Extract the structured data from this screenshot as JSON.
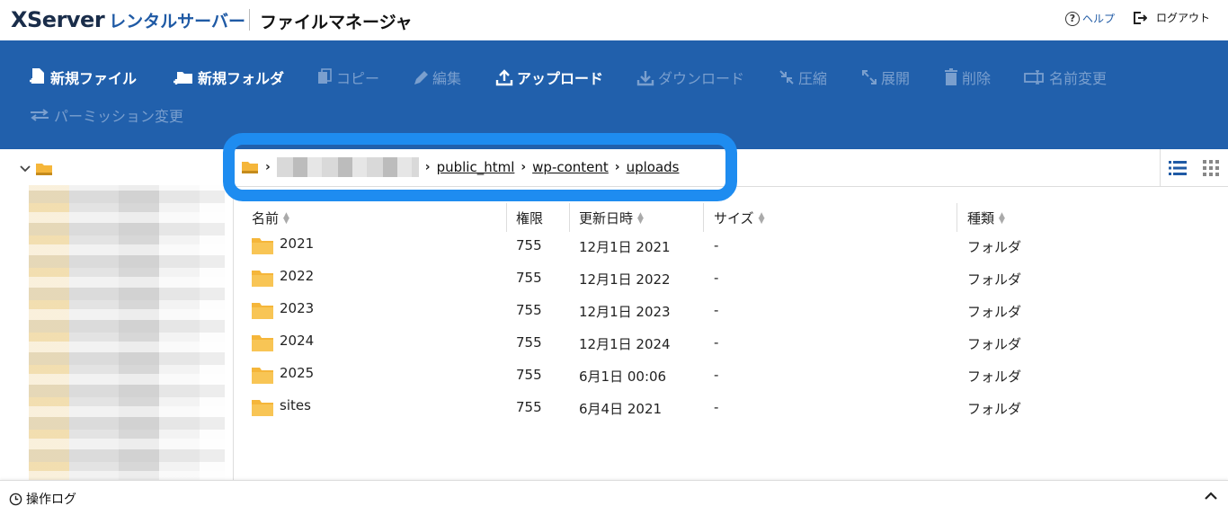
{
  "header": {
    "logo_brand": "XServer",
    "logo_sub": "レンタルサーバー",
    "app_title": "ファイルマネージャ",
    "help_label": "ヘルプ",
    "logout_label": "ログアウト"
  },
  "toolbar": {
    "buttons": [
      {
        "label": "新規ファイル",
        "icon": "new-file-icon",
        "enabled": true
      },
      {
        "label": "新規フォルダ",
        "icon": "new-folder-icon",
        "enabled": true
      },
      {
        "label": "コピー",
        "icon": "copy-icon",
        "enabled": false
      },
      {
        "label": "編集",
        "icon": "edit-icon",
        "enabled": false
      },
      {
        "label": "アップロード",
        "icon": "upload-icon",
        "enabled": true
      },
      {
        "label": "ダウンロード",
        "icon": "download-icon",
        "enabled": false
      },
      {
        "label": "圧縮",
        "icon": "compress-icon",
        "enabled": false
      },
      {
        "label": "展開",
        "icon": "expand-icon",
        "enabled": false
      },
      {
        "label": "削除",
        "icon": "trash-icon",
        "enabled": false
      },
      {
        "label": "名前変更",
        "icon": "rename-icon",
        "enabled": false
      },
      {
        "label": "パーミッション変更",
        "icon": "permission-icon",
        "enabled": false
      }
    ]
  },
  "breadcrumb": {
    "items": [
      "public_html",
      "wp-content",
      "uploads"
    ]
  },
  "table": {
    "columns": [
      "名前",
      "権限",
      "更新日時",
      "サイズ",
      "種類"
    ],
    "rows": [
      {
        "name": "2021",
        "perm": "755",
        "updated": "12月1日 2021",
        "size": "-",
        "type": "フォルダ"
      },
      {
        "name": "2022",
        "perm": "755",
        "updated": "12月1日 2022",
        "size": "-",
        "type": "フォルダ"
      },
      {
        "name": "2023",
        "perm": "755",
        "updated": "12月1日 2023",
        "size": "-",
        "type": "フォルダ"
      },
      {
        "name": "2024",
        "perm": "755",
        "updated": "12月1日 2024",
        "size": "-",
        "type": "フォルダ"
      },
      {
        "name": "2025",
        "perm": "755",
        "updated": "6月1日 00:06",
        "size": "-",
        "type": "フォルダ"
      },
      {
        "name": "sites",
        "perm": "755",
        "updated": "6月4日 2021",
        "size": "-",
        "type": "フォルダ"
      }
    ]
  },
  "logbar": {
    "label": "操作ログ"
  },
  "colors": {
    "toolbar_bg": "#2160ac",
    "highlight": "#1e8cf0",
    "folder": "#f5b63a",
    "brand": "#1f5aa5"
  }
}
